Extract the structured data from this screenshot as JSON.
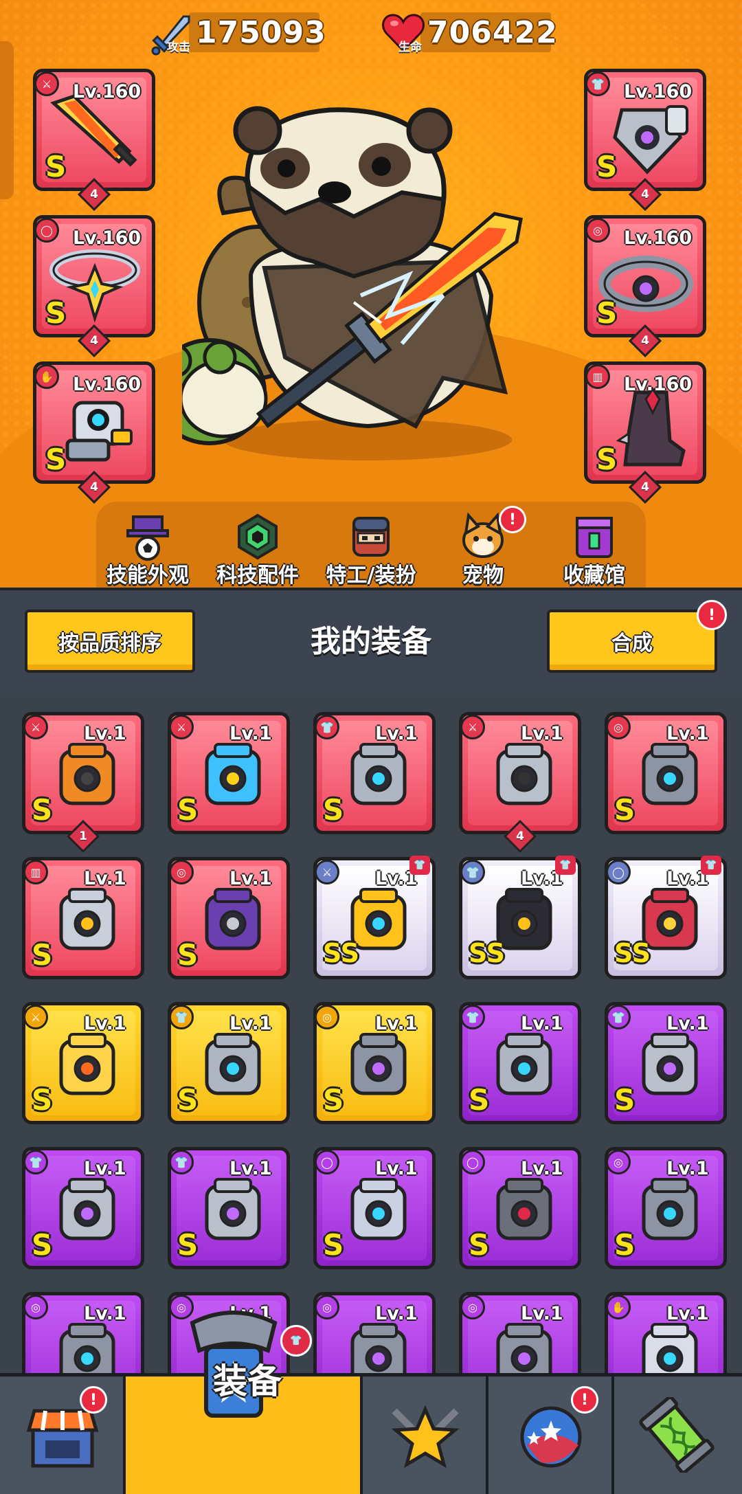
{
  "stats": {
    "attack": {
      "label": "攻击",
      "value": "175093"
    },
    "life": {
      "label": "生命",
      "value": "706422"
    }
  },
  "equipped": {
    "left": [
      {
        "level": "Lv.160",
        "grade": "S",
        "stars": "4",
        "slot_icon": "weapon-icon",
        "item": "flame-sword-icon",
        "rarity": "red"
      },
      {
        "level": "Lv.160",
        "grade": "S",
        "stars": "4",
        "slot_icon": "necklace-icon",
        "item": "star-necklace-icon",
        "rarity": "red"
      },
      {
        "level": "Lv.160",
        "grade": "S",
        "stars": "4",
        "slot_icon": "glove-icon",
        "item": "mech-gauntlet-icon",
        "rarity": "red"
      }
    ],
    "right": [
      {
        "level": "Lv.160",
        "grade": "S",
        "stars": "4",
        "slot_icon": "armor-icon",
        "item": "spiked-armor-icon",
        "rarity": "red"
      },
      {
        "level": "Lv.160",
        "grade": "S",
        "stars": "4",
        "slot_icon": "belt-icon",
        "item": "gem-belt-icon",
        "rarity": "red"
      },
      {
        "level": "Lv.160",
        "grade": "S",
        "stars": "4",
        "slot_icon": "boots-icon",
        "item": "spiked-boots-icon",
        "rarity": "red"
      }
    ]
  },
  "categories": [
    {
      "label": "技能外观",
      "icon": "hat-ball-icon"
    },
    {
      "label": "科技配件",
      "icon": "hex-chip-icon"
    },
    {
      "label": "特工/装扮",
      "icon": "agent-icon"
    },
    {
      "label": "宠物",
      "icon": "dog-icon",
      "badge": "!"
    },
    {
      "label": "收藏馆",
      "icon": "chest-icon"
    }
  ],
  "header": {
    "sort_label": "按品质排序",
    "title": "我的装备",
    "merge_label": "合成",
    "merge_badge": "!"
  },
  "inventory": [
    {
      "level": "Lv.1",
      "grade": "S",
      "rarity": "red",
      "slot_icon": "weapon-icon",
      "item": "turret-icon",
      "count": "1"
    },
    {
      "level": "Lv.1",
      "grade": "S",
      "rarity": "red",
      "slot_icon": "weapon-icon",
      "item": "water-gun-icon"
    },
    {
      "level": "Lv.1",
      "grade": "S",
      "rarity": "red",
      "slot_icon": "armor-icon",
      "item": "cyber-armor-icon"
    },
    {
      "level": "Lv.1",
      "grade": "",
      "rarity": "red",
      "slot_icon": "weapon-icon",
      "item": "kunai-icon",
      "count": "4"
    },
    {
      "level": "Lv.1",
      "grade": "S",
      "rarity": "red",
      "slot_icon": "belt-icon",
      "item": "hex-belt-icon"
    },
    {
      "level": "Lv.1",
      "grade": "S",
      "rarity": "red",
      "slot_icon": "boots-icon",
      "item": "mech-boot-icon"
    },
    {
      "level": "Lv.1",
      "grade": "S",
      "rarity": "red",
      "slot_icon": "belt-icon",
      "item": "purple-belt-icon"
    },
    {
      "level": "Lv.1",
      "grade": "SS",
      "rarity": "white",
      "slot_icon": "weapon-icon",
      "item": "gear-staff-icon",
      "tag": true
    },
    {
      "level": "Lv.1",
      "grade": "SS",
      "rarity": "white",
      "slot_icon": "armor-icon",
      "item": "samurai-armor-icon",
      "tag": true
    },
    {
      "level": "Lv.1",
      "grade": "SS",
      "rarity": "white",
      "slot_icon": "necklace-icon",
      "item": "star-choker-icon",
      "tag": true
    },
    {
      "level": "Lv.1",
      "grade": "S",
      "rarity": "gold",
      "slot_icon": "weapon-icon",
      "item": "flame-sword-icon"
    },
    {
      "level": "Lv.1",
      "grade": "S",
      "rarity": "gold",
      "slot_icon": "armor-icon",
      "item": "cyber-armor-icon"
    },
    {
      "level": "Lv.1",
      "grade": "S",
      "rarity": "gold",
      "slot_icon": "belt-icon",
      "item": "gem-belt-icon"
    },
    {
      "level": "Lv.1",
      "grade": "S",
      "rarity": "purple",
      "slot_icon": "armor-icon",
      "item": "cyber-armor-icon"
    },
    {
      "level": "Lv.1",
      "grade": "S",
      "rarity": "purple",
      "slot_icon": "armor-icon",
      "item": "spiked-armor-icon"
    },
    {
      "level": "Lv.1",
      "grade": "S",
      "rarity": "purple",
      "slot_icon": "armor-icon",
      "item": "spiked-armor-icon"
    },
    {
      "level": "Lv.1",
      "grade": "S",
      "rarity": "purple",
      "slot_icon": "armor-icon",
      "item": "spiked-armor-icon"
    },
    {
      "level": "Lv.1",
      "grade": "S",
      "rarity": "purple",
      "slot_icon": "necklace-icon",
      "item": "star-necklace-icon"
    },
    {
      "level": "Lv.1",
      "grade": "S",
      "rarity": "purple",
      "slot_icon": "necklace-icon",
      "item": "ruby-chain-icon"
    },
    {
      "level": "Lv.1",
      "grade": "S",
      "rarity": "purple",
      "slot_icon": "belt-icon",
      "item": "hex-belt-icon"
    },
    {
      "level": "Lv.1",
      "grade": "",
      "rarity": "purple",
      "slot_icon": "belt-icon",
      "item": "hex-belt-icon"
    },
    {
      "level": "Lv.1",
      "grade": "",
      "rarity": "purple",
      "slot_icon": "belt-icon",
      "item": "gem-belt-icon"
    },
    {
      "level": "Lv.1",
      "grade": "",
      "rarity": "purple",
      "slot_icon": "belt-icon",
      "item": "gem-belt-icon"
    },
    {
      "level": "Lv.1",
      "grade": "",
      "rarity": "purple",
      "slot_icon": "belt-icon",
      "item": "gem-belt-icon"
    },
    {
      "level": "Lv.1",
      "grade": "",
      "rarity": "purple",
      "slot_icon": "glove-icon",
      "item": "mech-gauntlet-icon"
    }
  ],
  "nav": {
    "items": [
      {
        "icon": "shop-icon",
        "badge": "!"
      },
      {
        "icon": "equipment-icon",
        "label": "装备",
        "active": true,
        "badge": "tag"
      },
      {
        "icon": "battle-star-icon"
      },
      {
        "icon": "planet-icon",
        "badge": "!"
      },
      {
        "icon": "dna-capsule-icon"
      }
    ]
  },
  "colors": {
    "orange_bg": "#ff9c14",
    "rarity_red": "#e0354e",
    "rarity_purple": "#8d22c9",
    "rarity_gold": "#f4ad0a",
    "rarity_white": "#e6e0f0",
    "button_yellow": "#ffc71c",
    "dark_panel": "#3a424c"
  }
}
